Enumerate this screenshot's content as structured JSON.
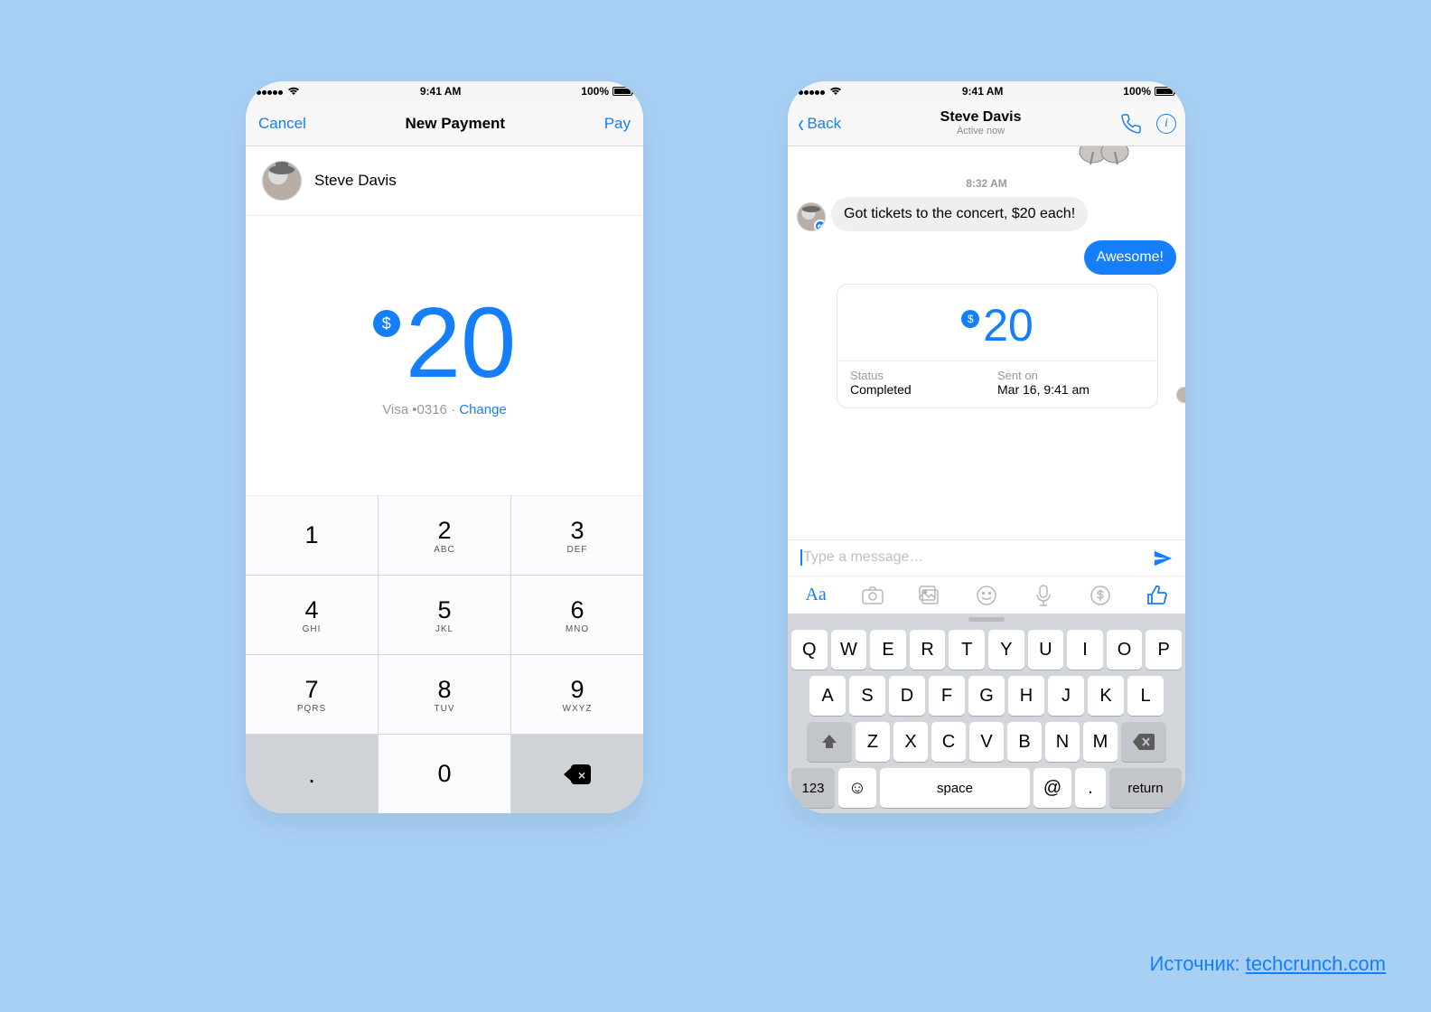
{
  "statusbar": {
    "time": "9:41 AM",
    "battery": "100%"
  },
  "left": {
    "nav": {
      "cancel": "Cancel",
      "title": "New Payment",
      "pay": "Pay"
    },
    "recipient_name": "Steve Davis",
    "amount": "20",
    "card_info": "Visa •0316 · ",
    "change": "Change",
    "keypad": [
      {
        "n": "1",
        "s": ""
      },
      {
        "n": "2",
        "s": "ABC"
      },
      {
        "n": "3",
        "s": "DEF"
      },
      {
        "n": "4",
        "s": "GHI"
      },
      {
        "n": "5",
        "s": "JKL"
      },
      {
        "n": "6",
        "s": "MNO"
      },
      {
        "n": "7",
        "s": "PQRS"
      },
      {
        "n": "8",
        "s": "TUV"
      },
      {
        "n": "9",
        "s": "WXYZ"
      },
      {
        "n": ".",
        "s": ""
      },
      {
        "n": "0",
        "s": ""
      },
      {
        "n": "DEL",
        "s": ""
      }
    ]
  },
  "right": {
    "nav": {
      "back": "Back",
      "name": "Steve Davis",
      "sub": "Active now"
    },
    "timestamp": "8:32 AM",
    "msg_in": "Got tickets to the concert, $20 each!",
    "msg_out": "Awesome!",
    "pay": {
      "amount": "20",
      "status_label": "Status",
      "status_value": "Completed",
      "sent_label": "Sent on",
      "sent_value": "Mar 16, 9:41 am"
    },
    "compose_placeholder": "Type a message…",
    "toolbar_aa": "Aa",
    "kbd": {
      "r1": [
        "Q",
        "W",
        "E",
        "R",
        "T",
        "Y",
        "U",
        "I",
        "O",
        "P"
      ],
      "r2": [
        "A",
        "S",
        "D",
        "F",
        "G",
        "H",
        "J",
        "K",
        "L"
      ],
      "r3": [
        "Z",
        "X",
        "C",
        "V",
        "B",
        "N",
        "M"
      ],
      "num": "123",
      "space": "space",
      "at": "@",
      "dot": ".",
      "return": "return"
    }
  },
  "source": {
    "label": "Источник: ",
    "link": "techcrunch.com"
  }
}
